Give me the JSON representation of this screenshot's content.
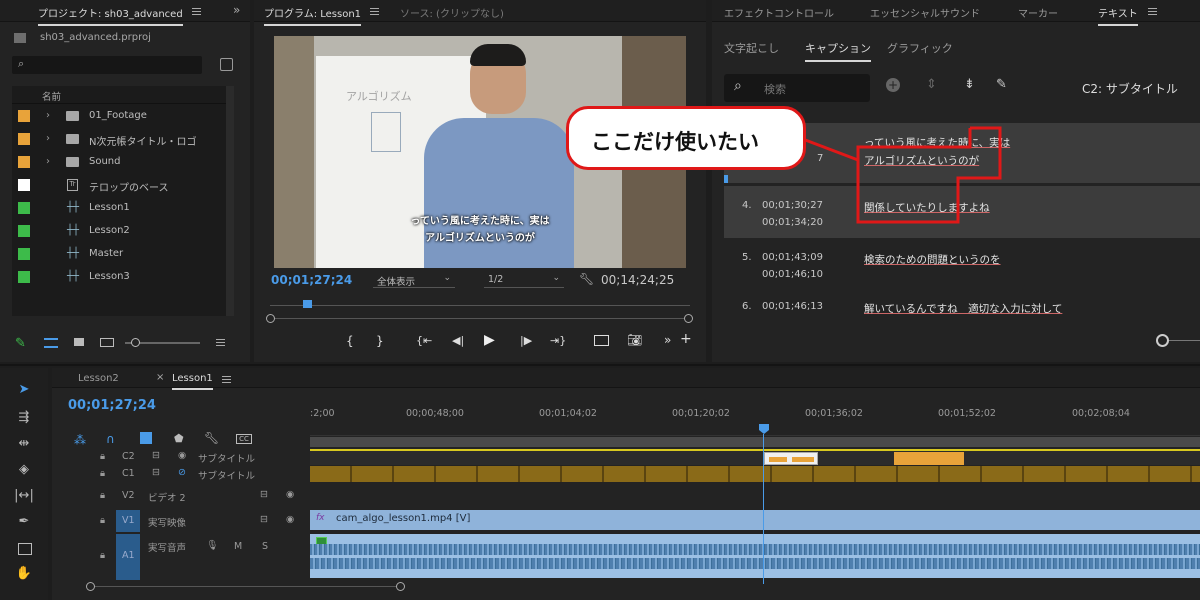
{
  "project_panel": {
    "title": "プロジェクト: sh03_advanced",
    "file_name": "sh03_advanced.prproj",
    "column_name": "名前",
    "items": [
      {
        "label": "01_Footage",
        "type": "folder",
        "color": "#e8a33a"
      },
      {
        "label": "N次元帳タイトル・ロゴ",
        "type": "folder",
        "color": "#e8a33a"
      },
      {
        "label": "Sound",
        "type": "folder",
        "color": "#e8a33a"
      },
      {
        "label": "テロップのベース",
        "type": "graphic",
        "color": "#ffffff"
      },
      {
        "label": "Lesson1",
        "type": "sequence",
        "color": "#3dbb4a"
      },
      {
        "label": "Lesson2",
        "type": "sequence",
        "color": "#3dbb4a"
      },
      {
        "label": "Master",
        "type": "sequence",
        "color": "#3dbb4a"
      },
      {
        "label": "Lesson3",
        "type": "sequence",
        "color": "#3dbb4a"
      }
    ]
  },
  "program_monitor": {
    "tab_program": "プログラム: Lesson1",
    "tab_source": "ソース: (クリップなし)",
    "subtitle_line1": "っていう風に考えた時に、実は",
    "subtitle_line2": "アルゴリズムというのが",
    "board_text": "アルゴリズム",
    "timecode": "00;01;27;24",
    "zoom": "全体表示",
    "resolution": "1/2",
    "duration": "00;14;24;25"
  },
  "text_panel": {
    "tabs": [
      "エフェクトコントロール",
      "エッセンシャルサウンド",
      "マーカー",
      "テキスト"
    ],
    "subtabs": [
      "文字起こし",
      "キャプション",
      "グラフィック"
    ],
    "search_placeholder": "検索",
    "track_label": "C2: サブタイトル",
    "captions": [
      {
        "num": "",
        "in": "",
        "out": "7",
        "line1": "っていう風に考えた時に、実は",
        "line2": "アルゴリズムというのが"
      },
      {
        "num": "4.",
        "in": "00;01;30;27",
        "out": "00;01;34;20",
        "line1": "関係していたりしますよね",
        "line2": ""
      },
      {
        "num": "5.",
        "in": "00;01;43;09",
        "out": "00;01;46;10",
        "line1": "検索のための問題というのを",
        "line2": ""
      },
      {
        "num": "6.",
        "in": "00;01;46;13",
        "out": "",
        "line1": "解いているんですね　適切な入力に対して",
        "line2": ""
      }
    ]
  },
  "callout": {
    "text": "ここだけ使いたい"
  },
  "timeline": {
    "tabs": [
      "Lesson2",
      "Lesson1"
    ],
    "timecode": "00;01;27;24",
    "ruler": [
      ":2;00",
      "00;00;48;00",
      "00;01;04;02",
      "00;01;20;02",
      "00;01;36;02",
      "00;01;52;02",
      "00;02;08;04"
    ],
    "tracks": {
      "c2": {
        "id": "C2",
        "name": "サブタイトル"
      },
      "c1": {
        "id": "C1",
        "name": "サブタイトル"
      },
      "v2": {
        "id": "V2",
        "name": "ビデオ 2"
      },
      "v1": {
        "id": "V1",
        "name": "実写映像"
      },
      "a1": {
        "id": "A1",
        "name": "実写音声",
        "m": "M",
        "s": "S"
      }
    },
    "clip_name": "cam_algo_lesson1.mp4 [V]",
    "fx": "fx"
  }
}
